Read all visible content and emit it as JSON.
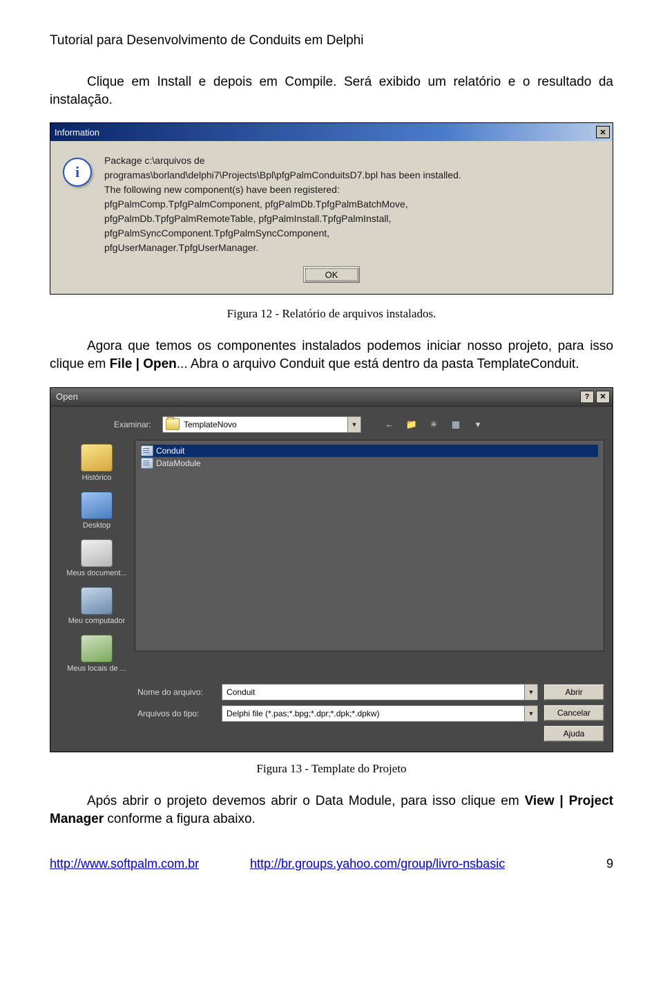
{
  "doc": {
    "header": "Tutorial para Desenvolvimento de Conduits em Delphi",
    "p1": "Clique em Install e depois em Compile. Será exibido um relatório e o resultado da instalação.",
    "caption1": "Figura 12 - Relatório de arquivos instalados.",
    "p2a": "Agora que temos os componentes instalados podemos iniciar nosso projeto, para isso clique em ",
    "p2b": "File | Open",
    "p2c": "... Abra o arquivo Conduit que está dentro da pasta TemplateConduit.",
    "caption2": "Figura 13 - Template do Projeto",
    "p3a": "Após abrir o projeto devemos abrir o Data Module, para isso clique em ",
    "p3b": "View | Project Manager",
    "p3c": " conforme a figura abaixo."
  },
  "info_dialog": {
    "title": "Information",
    "message": "Package c:\\arquivos de\nprogramas\\borland\\delphi7\\Projects\\Bpl\\pfgPalmConduitsD7.bpl has been installed.\nThe following new component(s) have been registered:\npfgPalmComp.TpfgPalmComponent, pfgPalmDb.TpfgPalmBatchMove,\npfgPalmDb.TpfgPalmRemoteTable, pfgPalmInstall.TpfgPalmInstall,\npfgPalmSyncComponent.TpfgPalmSyncComponent,\npfgUserManager.TpfgUserManager.",
    "ok": "OK"
  },
  "open_dialog": {
    "title": "Open",
    "examine_label": "Examinar:",
    "folder": "TemplateNovo",
    "toolbar": {
      "back": "←",
      "up": "📁",
      "newfolder": "✳",
      "views": "▦",
      "views_arrow": "▾"
    },
    "places": [
      {
        "icon": "folder",
        "label": "Histórico"
      },
      {
        "icon": "desktop",
        "label": "Desktop"
      },
      {
        "icon": "docs",
        "label": "Meus document..."
      },
      {
        "icon": "computer",
        "label": "Meu computador"
      },
      {
        "icon": "network",
        "label": "Meus locais de ..."
      }
    ],
    "files": [
      {
        "name": "Conduit",
        "selected": true
      },
      {
        "name": "DataModule",
        "selected": false
      }
    ],
    "filename_label": "Nome do arquivo:",
    "filename_value": "Conduit",
    "filetype_label": "Arquivos do tipo:",
    "filetype_value": "Delphi file (*.pas;*.bpg;*.dpr;*.dpk;*.dpkw)",
    "btn_open": "Abrir",
    "btn_cancel": "Cancelar",
    "btn_help": "Ajuda"
  },
  "footer": {
    "link1": "http://www.softpalm.com.br",
    "link2": "http://br.groups.yahoo.com/group/livro-nsbasic",
    "page": "9"
  }
}
